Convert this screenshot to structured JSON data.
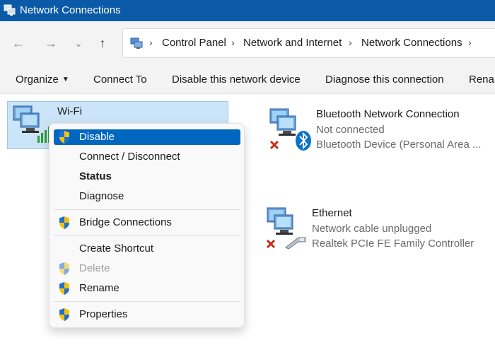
{
  "window": {
    "title": "Network Connections"
  },
  "nav": {
    "back_icon": "arrow-left-icon",
    "forward_icon": "arrow-right-icon",
    "recent_icon": "chevron-down-icon",
    "up_icon": "arrow-up-icon",
    "back": "←",
    "forward": "→",
    "recent": "⌄",
    "up": "↑",
    "separator": "›",
    "breadcrumbs": [
      "Control Panel",
      "Network and Internet",
      "Network Connections"
    ]
  },
  "toolbar": {
    "organize": "Organize",
    "connect_to": "Connect To",
    "disable_device": "Disable this network device",
    "diagnose": "Diagnose this connection",
    "rename_partial": "Renar"
  },
  "connections": [
    {
      "name": "Wi-Fi",
      "status": "",
      "device": "",
      "state": "connected",
      "selected": true
    },
    {
      "name": "Bluetooth Network Connection",
      "status": "Not connected",
      "device": "Bluetooth Device (Personal Area ...",
      "state": "disconnected"
    },
    {
      "name": "Ethernet",
      "status": "Network cable unplugged",
      "device": "Realtek PCIe FE Family Controller",
      "state": "disconnected"
    }
  ],
  "context_menu": {
    "items": [
      {
        "label": "Disable",
        "shield": true,
        "highlighted": true
      },
      {
        "label": "Connect / Disconnect"
      },
      {
        "label": "Status",
        "bold": true
      },
      {
        "label": "Diagnose"
      },
      {
        "label": "Bridge Connections",
        "shield": true
      },
      {
        "label": "Create Shortcut"
      },
      {
        "label": "Delete",
        "shield": true,
        "disabled": true
      },
      {
        "label": "Rename",
        "shield": true
      },
      {
        "label": "Properties",
        "shield": true
      }
    ]
  },
  "colors": {
    "title_bar": "#0b5aa8",
    "selection_bg": "#cce4f7",
    "menu_highlight": "#0067c0",
    "error_red": "#c42b1c",
    "bluetooth_blue": "#0a72c9"
  }
}
